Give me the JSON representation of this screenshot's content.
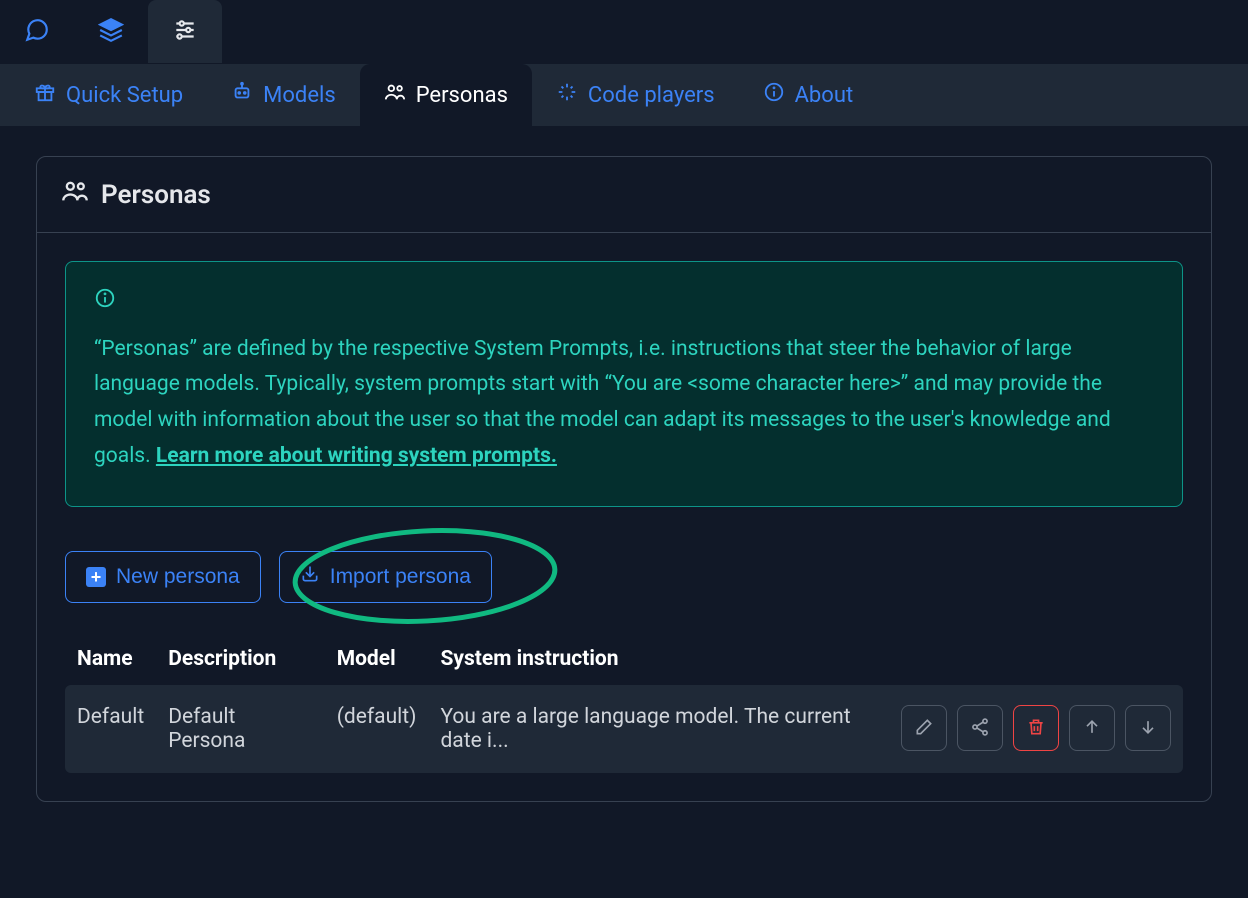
{
  "topTabs": {
    "chat": "chat",
    "layers": "layers",
    "settings": "settings"
  },
  "nav": {
    "quick_setup": "Quick Setup",
    "models": "Models",
    "personas": "Personas",
    "code_players": "Code players",
    "about": "About"
  },
  "panel": {
    "title": "Personas"
  },
  "info": {
    "text": "“Personas” are defined by the respective System Prompts, i.e. instructions that steer the behavior of large language models. Typically, system prompts start with “You are <some character here>” and may provide the model with information about the user so that the model can adapt its messages to the user's knowledge and goals. ",
    "link_text": "Learn more about writing system prompts."
  },
  "buttons": {
    "new_persona": "New persona",
    "import_persona": "Import persona"
  },
  "table": {
    "headers": {
      "name": "Name",
      "description": "Description",
      "model": "Model",
      "system": "System instruction"
    },
    "rows": [
      {
        "name": "Default",
        "description": "Default Persona",
        "model": "(default)",
        "system": "You are a large language model. The current date i..."
      }
    ]
  },
  "annotation": {
    "highlight": "import-persona-button"
  }
}
